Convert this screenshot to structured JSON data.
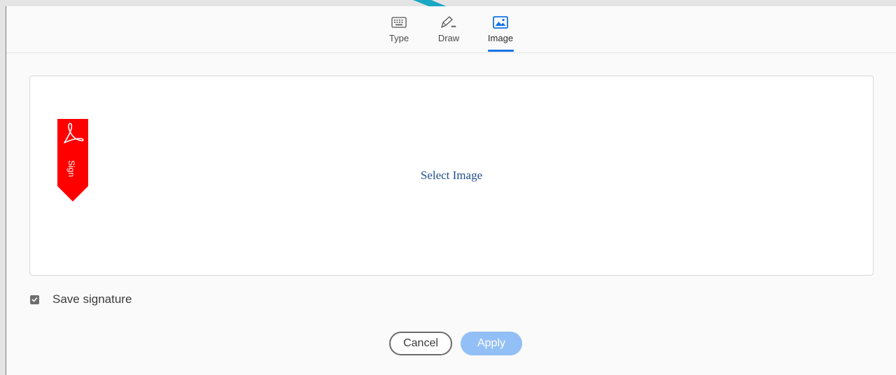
{
  "tabs": [
    {
      "label": "Type",
      "icon": "keyboard-icon"
    },
    {
      "label": "Draw",
      "icon": "pen-icon"
    },
    {
      "label": "Image",
      "icon": "image-icon",
      "selected": true
    }
  ],
  "drop_area": {
    "badge_text": "Sign",
    "select_label": "Select Image"
  },
  "save_signature": {
    "label": "Save signature",
    "checked": true
  },
  "buttons": {
    "cancel_label": "Cancel",
    "apply_label": "Apply"
  },
  "colors": {
    "accent": "#1473e6",
    "apply_disabled": "#92bff5",
    "annotation_arrow": "#1aa7c4",
    "badge_red": "#ff0000",
    "select_link": "#1f4e8c"
  }
}
